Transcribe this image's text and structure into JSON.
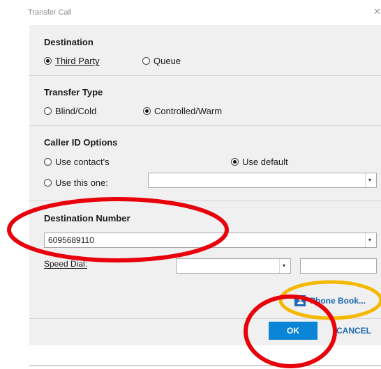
{
  "window": {
    "title": "Transfer Call",
    "close_glyph": "✕"
  },
  "destination": {
    "title": "Destination",
    "options": [
      {
        "label": "Third Party",
        "selected": true
      },
      {
        "label": "Queue",
        "selected": false
      }
    ]
  },
  "transfer_type": {
    "title": "Transfer Type",
    "options": [
      {
        "label": "Blind/Cold",
        "selected": false
      },
      {
        "label": "Controlled/Warm",
        "selected": true
      }
    ]
  },
  "caller_id": {
    "title": "Caller ID Options",
    "use_contact_label": "Use contact's",
    "use_default_label": "Use default",
    "use_this_one_label": "Use this one:",
    "use_contact_selected": false,
    "use_default_selected": true,
    "use_this_one_selected": false,
    "use_this_one_value": ""
  },
  "destination_number": {
    "title": "Destination Number",
    "value": "6095689110"
  },
  "speed_dial": {
    "label": "Speed Dial:",
    "combo_value": "",
    "text_value": ""
  },
  "buttons": {
    "phone_book": "Phone Book...",
    "ok": "OK",
    "cancel": "CANCEL"
  },
  "colors": {
    "accent": "#0a84d6",
    "link": "#1b6ab3",
    "annotation_red": "#e8000b",
    "annotation_orange": "#f5b800"
  }
}
